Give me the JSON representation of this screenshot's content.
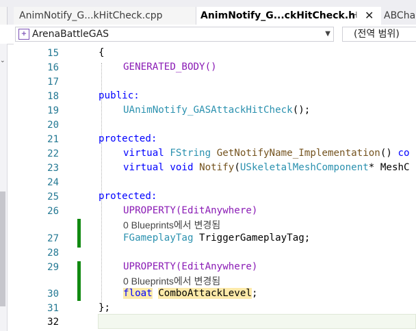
{
  "tabs": [
    {
      "label": "AnimNotify_G...kHitCheck.cpp",
      "active": false
    },
    {
      "label": "AnimNotify_G...ckHitCheck.h",
      "active": true,
      "pin_icon": "pin-icon",
      "close_icon": "close-icon"
    },
    {
      "label": "ABCha",
      "active": false
    }
  ],
  "navbar": {
    "project": "ArenaBattleGAS",
    "scope": "(전역 범위)"
  },
  "editor": {
    "lines": [
      {
        "num": "15",
        "text": "{"
      },
      {
        "num": "16",
        "text": "GENERATED_BODY()"
      },
      {
        "num": "17",
        "text": ""
      },
      {
        "num": "18",
        "text": "public:"
      },
      {
        "num": "19",
        "text": "UAnimNotify_GASAttackHitCheck();"
      },
      {
        "num": "20",
        "text": ""
      },
      {
        "num": "21",
        "text": "protected:"
      },
      {
        "num": "22",
        "text": "virtual FString GetNotifyName_Implementation() co"
      },
      {
        "num": "23",
        "text": "virtual void Notify(USkeletalMeshComponent* MeshC"
      },
      {
        "num": "24",
        "text": ""
      },
      {
        "num": "25",
        "text": "protected:"
      },
      {
        "num": "26",
        "text": "UPROPERTY(EditAnywhere)"
      },
      {
        "num": "27",
        "text": "FGameplayTag TriggerGameplayTag;"
      },
      {
        "num": "28",
        "text": ""
      },
      {
        "num": "29",
        "text": "UPROPERTY(EditAnywhere)"
      },
      {
        "num": "30",
        "text": "float ComboAttackLevel;"
      },
      {
        "num": "31",
        "text": "};"
      },
      {
        "num": "32",
        "text": ""
      }
    ],
    "codelens": [
      "0 Blueprints에서 변경됨",
      "0 Blueprints에서 변경됨"
    ]
  },
  "colors": {
    "keyword": "#0000ff",
    "macro": "#8a1bb5",
    "type": "#2b91af",
    "function": "#74531f",
    "change_bar": "#118a11",
    "highlight": "#fdeaaa"
  }
}
